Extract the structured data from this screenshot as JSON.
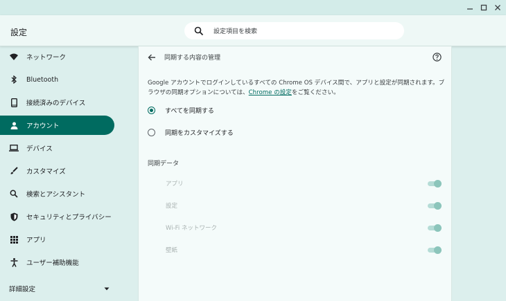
{
  "window": {
    "buttons": [
      {
        "name": "minimize-icon",
        "glyph": "—"
      },
      {
        "name": "maximize-icon",
        "glyph": "☐"
      },
      {
        "name": "close-icon",
        "glyph": "✕"
      }
    ]
  },
  "header": {
    "title": "設定",
    "search_placeholder": "設定項目を検索"
  },
  "sidebar": {
    "items": [
      {
        "label": "ネットワーク",
        "icon": "wifi-icon",
        "active": false
      },
      {
        "label": "Bluetooth",
        "icon": "bluetooth-icon",
        "active": false
      },
      {
        "label": "接続済みのデバイス",
        "icon": "phone-icon",
        "active": false
      },
      {
        "label": "アカウント",
        "icon": "person-icon",
        "active": true
      },
      {
        "label": "デバイス",
        "icon": "laptop-icon",
        "active": false
      },
      {
        "label": "カスタマイズ",
        "icon": "brush-icon",
        "active": false
      },
      {
        "label": "検索とアシスタント",
        "icon": "search-icon",
        "active": false
      },
      {
        "label": "セキュリティとプライバシー",
        "icon": "shield-icon",
        "active": false
      },
      {
        "label": "アプリ",
        "icon": "apps-grid-icon",
        "active": false
      },
      {
        "label": "ユーザー補助機能",
        "icon": "accessibility-icon",
        "active": false
      }
    ],
    "advanced_label": "詳細設定"
  },
  "main": {
    "page_title": "同期する内容の管理",
    "description_part1": "Google アカウントでログインしているすべての Chrome OS デバイス間で、アプリと設定が同期されます。ブラウザの同期オプションについては、",
    "description_link": "Chrome の設定",
    "description_part2": "をご覧ください。",
    "options": [
      {
        "label": "すべてを同期する",
        "selected": true
      },
      {
        "label": "同期をカスタマイズする",
        "selected": false
      }
    ],
    "sync_section_title": "同期データ",
    "sync_items": [
      {
        "label": "アプリ",
        "enabled": true,
        "disabled": true
      },
      {
        "label": "設定",
        "enabled": true,
        "disabled": true
      },
      {
        "label": "Wi-Fi ネットワーク",
        "enabled": true,
        "disabled": true
      },
      {
        "label": "壁紙",
        "enabled": true,
        "disabled": true
      }
    ]
  },
  "colors": {
    "accent": "#006b60",
    "background": "#dcefed",
    "toggle_track": "#b5dcd6",
    "toggle_knob": "#8cc5bb"
  }
}
